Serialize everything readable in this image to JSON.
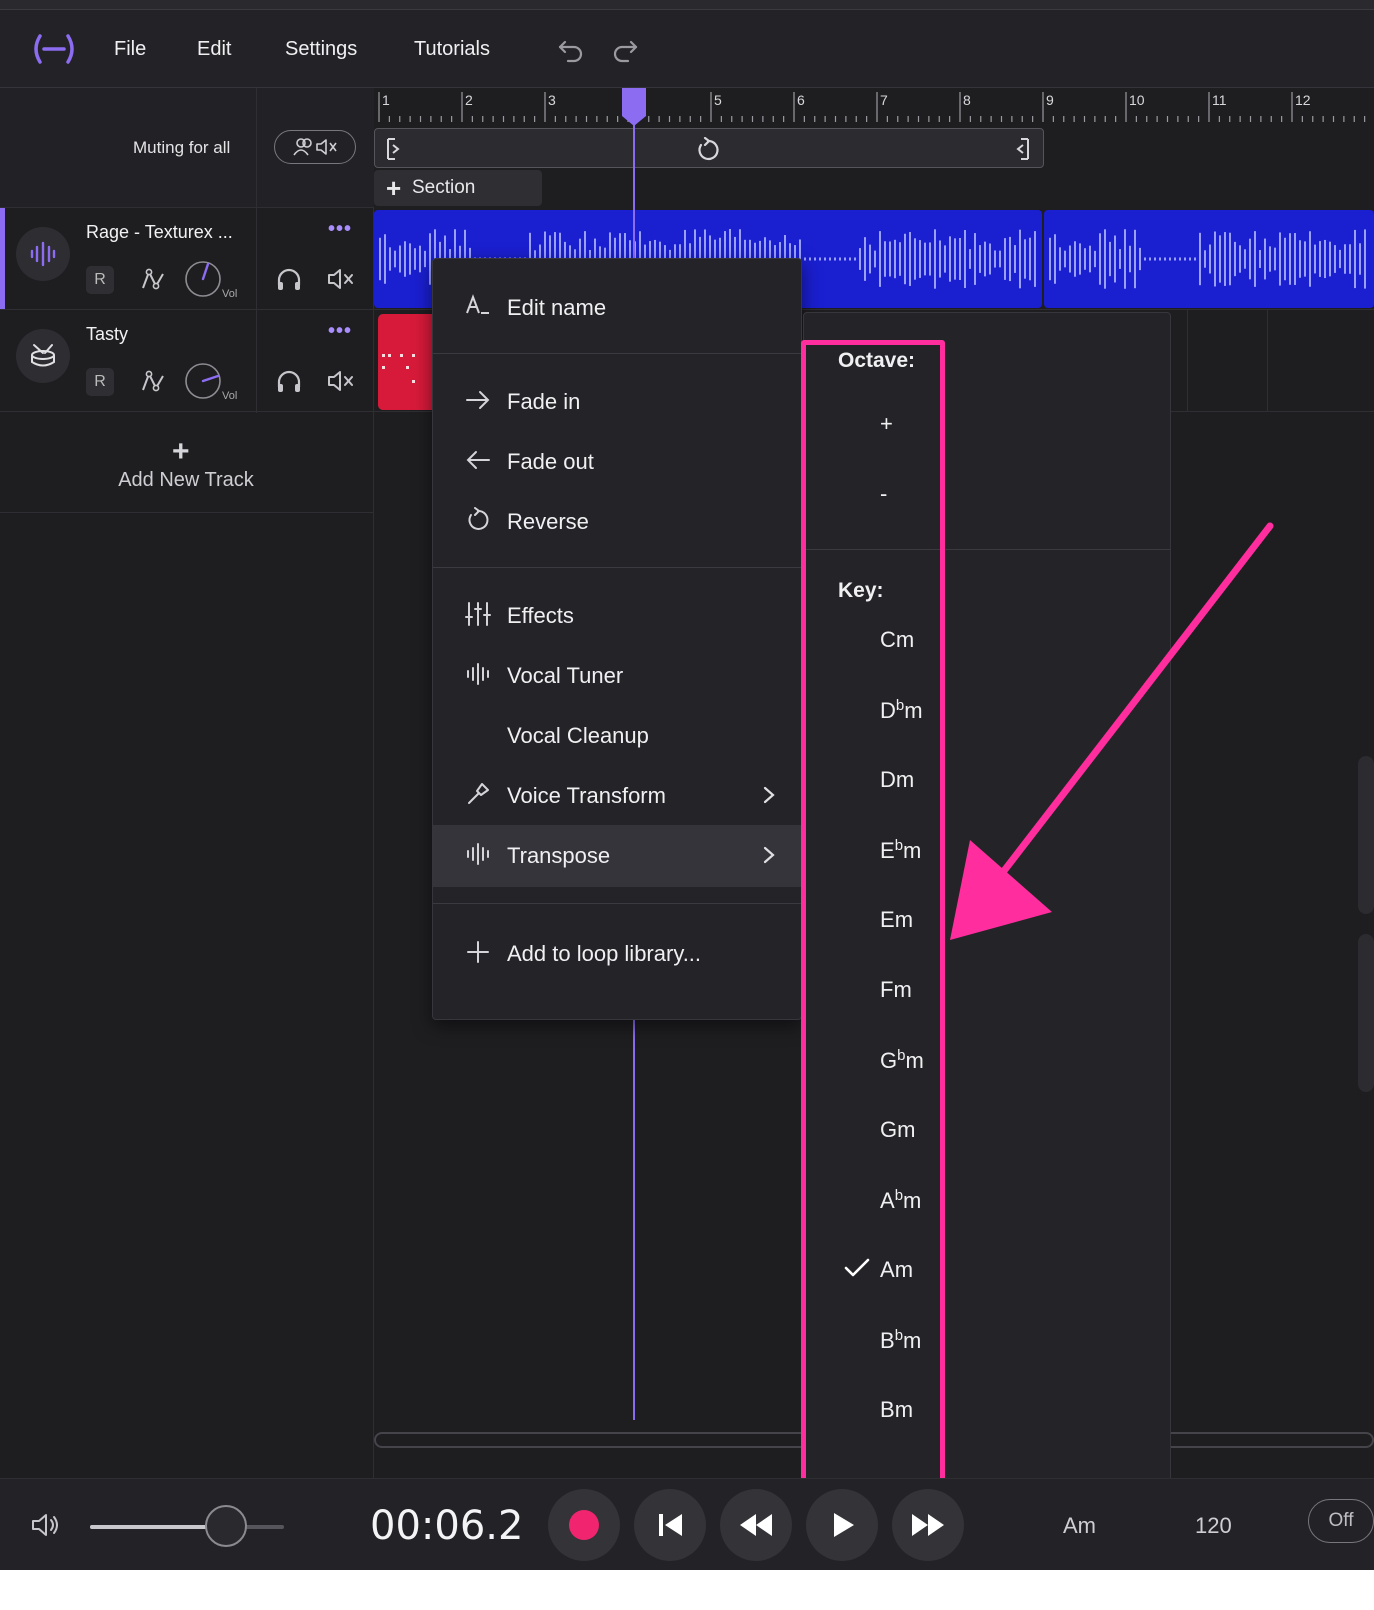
{
  "menubar": {
    "items": [
      "File",
      "Edit",
      "Settings",
      "Tutorials"
    ]
  },
  "muting": {
    "label": "Muting for all"
  },
  "tracks": [
    {
      "name": "Rage - Texturex ...",
      "record": "R",
      "vol_label": "Vol"
    },
    {
      "name": "Tasty",
      "record": "R",
      "vol_label": "Vol"
    }
  ],
  "add_track": {
    "label": "Add New Track"
  },
  "ruler": {
    "bars": [
      "1",
      "2",
      "3",
      "4",
      "5",
      "6",
      "7",
      "8",
      "9",
      "10",
      "11",
      "12"
    ]
  },
  "section_button": {
    "label": "Section"
  },
  "context_menu": {
    "items": [
      {
        "label": "Edit name",
        "icon": "text-icon"
      },
      {
        "label": "Fade in",
        "icon": "arrow-right-icon"
      },
      {
        "label": "Fade out",
        "icon": "arrow-left-icon"
      },
      {
        "label": "Reverse",
        "icon": "reverse-icon"
      },
      {
        "label": "Effects",
        "icon": "sliders-icon"
      },
      {
        "label": "Vocal Tuner",
        "icon": "waveform-icon"
      },
      {
        "label": "Vocal Cleanup",
        "icon": ""
      },
      {
        "label": "Voice Transform",
        "icon": "wand-icon",
        "submenu": true
      },
      {
        "label": "Transpose",
        "icon": "waveform-icon",
        "submenu": true,
        "active": true
      },
      {
        "label": "Add to loop library...",
        "icon": "plus-icon"
      }
    ]
  },
  "transpose_submenu": {
    "octave_title": "Octave:",
    "octave_items": [
      "+",
      "-"
    ],
    "key_title": "Key:",
    "keys": [
      {
        "root": "C",
        "flat": "",
        "suffix": "m"
      },
      {
        "root": "D",
        "flat": "b",
        "suffix": "m"
      },
      {
        "root": "D",
        "flat": "",
        "suffix": "m"
      },
      {
        "root": "E",
        "flat": "b",
        "suffix": "m"
      },
      {
        "root": "E",
        "flat": "",
        "suffix": "m"
      },
      {
        "root": "F",
        "flat": "",
        "suffix": "m"
      },
      {
        "root": "G",
        "flat": "b",
        "suffix": "m"
      },
      {
        "root": "G",
        "flat": "",
        "suffix": "m"
      },
      {
        "root": "A",
        "flat": "b",
        "suffix": "m"
      },
      {
        "root": "A",
        "flat": "",
        "suffix": "m"
      },
      {
        "root": "B",
        "flat": "b",
        "suffix": "m"
      },
      {
        "root": "B",
        "flat": "",
        "suffix": "m"
      }
    ],
    "selected_key": "Am"
  },
  "transport": {
    "timecode": "00:06.2",
    "volume_level": 0.7,
    "key": "Am",
    "bpm": "120",
    "metronome": "Off"
  },
  "colors": {
    "accent": "#8c6cf0",
    "clip_blue": "#1a1fd0",
    "clip_red": "#d71a3a",
    "record": "#f0246f",
    "annotation": "#ff2d9e"
  }
}
